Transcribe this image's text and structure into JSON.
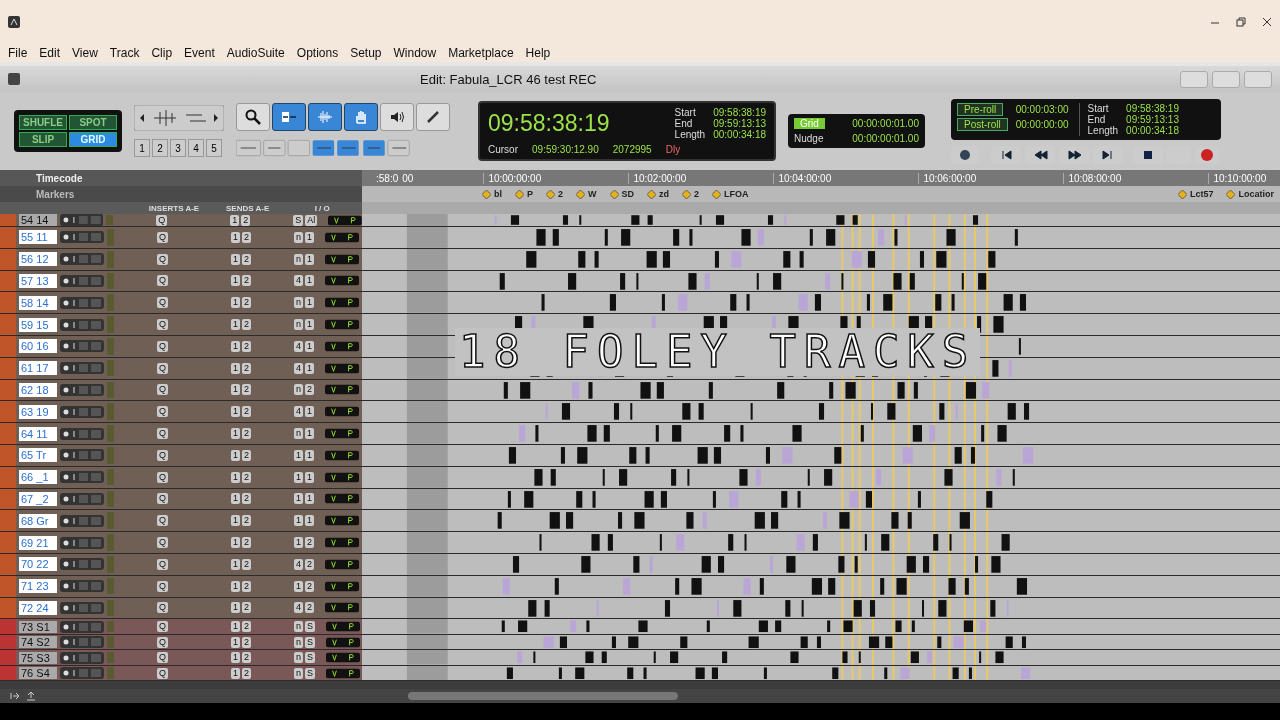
{
  "menu": [
    "File",
    "Edit",
    "View",
    "Track",
    "Clip",
    "Event",
    "AudioSuite",
    "Options",
    "Setup",
    "Window",
    "Marketplace",
    "Help"
  ],
  "edit_title": "Edit: Fabula_LCR 46 test REC",
  "edit_modes": [
    {
      "label": "SHUFLE",
      "selected": false
    },
    {
      "label": "SPOT",
      "selected": false
    },
    {
      "label": "SLIP",
      "selected": false
    },
    {
      "label": "GRID",
      "selected": true
    }
  ],
  "zoom_presets": [
    "1",
    "2",
    "3",
    "4",
    "5"
  ],
  "tools": [
    {
      "kind": "zoom",
      "selected": false
    },
    {
      "kind": "trim",
      "selected": true
    },
    {
      "kind": "select",
      "selected": true
    },
    {
      "kind": "grab",
      "selected": true
    },
    {
      "kind": "scrub",
      "selected": false
    },
    {
      "kind": "pencil",
      "selected": false
    }
  ],
  "counter": {
    "main": "09:58:38:19",
    "cursor_label": "Cursor",
    "cursor": "09:59:30:12.90",
    "samples": "2072995",
    "dly": "Dly"
  },
  "selection": [
    {
      "label": "Start",
      "value": "09:58:38:19"
    },
    {
      "label": "End",
      "value": "09:59:13:13"
    },
    {
      "label": "Length",
      "value": "00:00:34:18"
    }
  ],
  "grid": {
    "label": "Grid",
    "value": "00:00:00:01.00"
  },
  "nudge": {
    "label": "Nudge",
    "value": "00:00:00:01.00"
  },
  "preroll": {
    "label": "Pre-roll",
    "value": "00:00:03:00"
  },
  "postroll": {
    "label": "Post-roll",
    "value": "00:00:00:00"
  },
  "transport_selection": [
    {
      "label": "Start",
      "value": "09:58:38:19"
    },
    {
      "label": "End",
      "value": "09:59:13:13"
    },
    {
      "label": "Length",
      "value": "00:00:34:18"
    }
  ],
  "ruler": {
    "label": "Timecode",
    "lead_a": ":58:0",
    "lead_b": "00",
    "times": [
      "10:00:00:00",
      "10:02:00:00",
      "10:04:00:00",
      "10:06:00:00",
      "10:08:00:00",
      "10:10:00:00"
    ]
  },
  "markers": {
    "label": "Markers",
    "items": [
      "bl",
      "P",
      "2",
      "W",
      "SD",
      "zd",
      "2",
      "LFOA"
    ],
    "end_items": [
      "Lct57",
      "Locatior"
    ]
  },
  "columns": [
    "INSERTS A-E",
    "SENDS A-E",
    "I / O"
  ],
  "caption": "18 FOLEY TRACKS",
  "tracks": [
    {
      "name": "54 14",
      "kind": "partial",
      "insert": "Q",
      "sends": [
        "1",
        "2"
      ],
      "io_a": "S",
      "io_b": "Al"
    },
    {
      "name": "55 11",
      "kind": "audio",
      "insert": "Q",
      "sends": [
        "1",
        "2"
      ],
      "io_a": "n",
      "io_b": "1"
    },
    {
      "name": "56 12",
      "kind": "audio",
      "insert": "Q",
      "sends": [
        "1",
        "2"
      ],
      "io_a": "n",
      "io_b": "1"
    },
    {
      "name": "57 13",
      "kind": "audio",
      "insert": "Q",
      "sends": [
        "1",
        "2"
      ],
      "io_a": "4",
      "io_b": "1"
    },
    {
      "name": "58 14",
      "kind": "audio",
      "insert": "Q",
      "sends": [
        "1",
        "2"
      ],
      "io_a": "n",
      "io_b": "1"
    },
    {
      "name": "59 15",
      "kind": "audio",
      "insert": "Q",
      "sends": [
        "1",
        "2"
      ],
      "io_a": "n",
      "io_b": "1"
    },
    {
      "name": "60 16",
      "kind": "audio",
      "insert": "Q",
      "sends": [
        "1",
        "2"
      ],
      "io_a": "4",
      "io_b": "1"
    },
    {
      "name": "61 17",
      "kind": "audio",
      "insert": "Q",
      "sends": [
        "1",
        "2"
      ],
      "io_a": "4",
      "io_b": "1"
    },
    {
      "name": "62 18",
      "kind": "audio",
      "insert": "Q",
      "sends": [
        "1",
        "2"
      ],
      "io_a": "n",
      "io_b": "2"
    },
    {
      "name": "63 19",
      "kind": "audio",
      "insert": "Q",
      "sends": [
        "1",
        "2"
      ],
      "io_a": "4",
      "io_b": "1"
    },
    {
      "name": "64 11",
      "kind": "audio",
      "insert": "Q",
      "sends": [
        "1",
        "2"
      ],
      "io_a": "n",
      "io_b": "1"
    },
    {
      "name": "65 Tr",
      "kind": "audio",
      "insert": "Q",
      "sends": [
        "1",
        "2"
      ],
      "io_a": "1",
      "io_b": "1"
    },
    {
      "name": "66 _1",
      "kind": "audio",
      "insert": "Q",
      "sends": [
        "1",
        "2"
      ],
      "io_a": "1",
      "io_b": "1"
    },
    {
      "name": "67 _2",
      "kind": "audio",
      "insert": "Q",
      "sends": [
        "1",
        "2"
      ],
      "io_a": "1",
      "io_b": "1"
    },
    {
      "name": "68 Gr",
      "kind": "audio",
      "insert": "Q",
      "sends": [
        "1",
        "2"
      ],
      "io_a": "1",
      "io_b": "1"
    },
    {
      "name": "69 21",
      "kind": "audio",
      "insert": "Q",
      "sends": [
        "1",
        "2"
      ],
      "io_a": "1",
      "io_b": "2"
    },
    {
      "name": "70 22",
      "kind": "audio",
      "insert": "Q",
      "sends": [
        "1",
        "2"
      ],
      "io_a": "4",
      "io_b": "2"
    },
    {
      "name": "71 23",
      "kind": "audio",
      "insert": "Q",
      "sends": [
        "1",
        "2"
      ],
      "io_a": "1",
      "io_b": "2"
    },
    {
      "name": "72 24",
      "kind": "audio",
      "insert": "Q",
      "sends": [
        "1",
        "2"
      ],
      "io_a": "4",
      "io_b": "2"
    },
    {
      "name": "73 S1",
      "kind": "small",
      "insert": "Q",
      "sends": [
        "1",
        "2"
      ],
      "io_a": "n",
      "io_b": "S"
    },
    {
      "name": "74 S2",
      "kind": "small",
      "insert": "Q",
      "sends": [
        "1",
        "2"
      ],
      "io_a": "n",
      "io_b": "S"
    },
    {
      "name": "75 S3",
      "kind": "small",
      "insert": "Q",
      "sends": [
        "1",
        "2"
      ],
      "io_a": "n",
      "io_b": "S"
    },
    {
      "name": "76 S4",
      "kind": "small",
      "insert": "Q",
      "sends": [
        "1",
        "2"
      ],
      "io_a": "n",
      "io_b": "S"
    }
  ]
}
